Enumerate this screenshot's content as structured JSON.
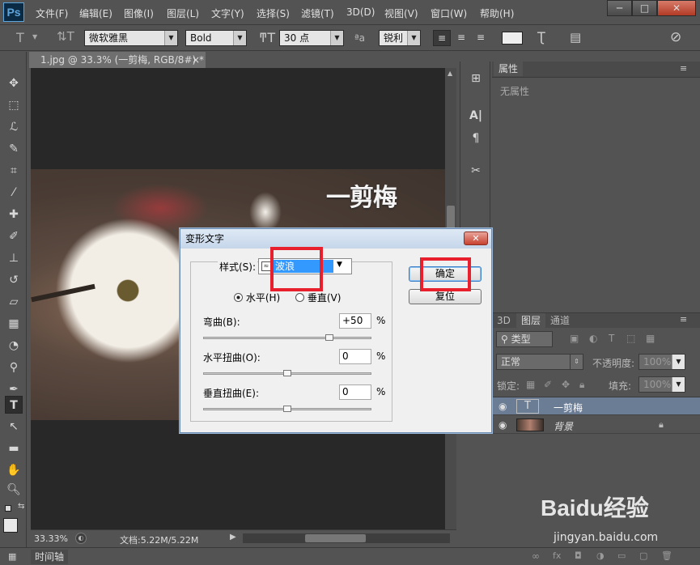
{
  "app": {
    "logo": "Ps"
  },
  "menubar": {
    "items": [
      "文件(F)",
      "编辑(E)",
      "图像(I)",
      "图层(L)",
      "文字(Y)",
      "选择(S)",
      "滤镜(T)",
      "3D(D)",
      "视图(V)",
      "窗口(W)",
      "帮助(H)"
    ]
  },
  "window_controls": {
    "minimize": "─",
    "maximize": "□",
    "close": "✕"
  },
  "options": {
    "font_family": "微软雅黑",
    "font_style": "Bold",
    "font_size": "30 点",
    "anti_alias": "锐利",
    "aa_label": "ªa"
  },
  "document": {
    "tab_title": "1.jpg @ 33.3% (一剪梅, RGB/8#) *",
    "tab_close": "×",
    "canvas_text": "一剪梅"
  },
  "status": {
    "zoom": "33.33%",
    "doc_info": "文档:5.22M/5.22M"
  },
  "timeline": {
    "label": "时间轴"
  },
  "properties": {
    "tab": "属性",
    "empty_text": "无属性"
  },
  "layers": {
    "tabs": [
      "3D",
      "图层",
      "通道"
    ],
    "filter_kind": "类型",
    "blend_mode": "正常",
    "opacity_label": "不透明度:",
    "opacity": "100%",
    "lock_label": "锁定:",
    "fill_label": "填充:",
    "fill": "100%",
    "items": [
      {
        "name": "一剪梅",
        "type": "T"
      },
      {
        "name": "背景",
        "type": "image"
      }
    ]
  },
  "dialog": {
    "title": "变形文字",
    "close": "✕",
    "style_label": "样式(S):",
    "style_value": "波浪",
    "horizontal": "水平(H)",
    "vertical": "垂直(V)",
    "bend_label": "弯曲(B):",
    "bend_value": "+50",
    "hdist_label": "水平扭曲(O):",
    "hdist_value": "0",
    "vdist_label": "垂直扭曲(E):",
    "vdist_value": "0",
    "percent": "%",
    "ok": "确定",
    "reset": "复位",
    "bend_level": 0.75,
    "hdist_level": 0.5,
    "vdist_level": 0.5
  },
  "watermark": {
    "brand": "Baidu经验",
    "url": "jingyan.baidu.com"
  }
}
